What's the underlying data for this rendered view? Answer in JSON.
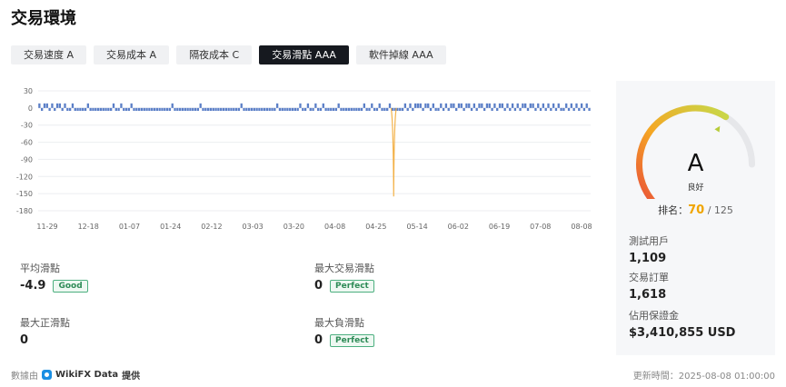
{
  "page": {
    "title": "交易環境"
  },
  "tabs": [
    {
      "label": "交易速度 A",
      "active": false
    },
    {
      "label": "交易成本 A",
      "active": false
    },
    {
      "label": "隔夜成本 C",
      "active": false
    },
    {
      "label": "交易滑點 AAA",
      "active": true
    },
    {
      "label": "軟件掉線 AAA",
      "active": false
    }
  ],
  "chart_data": {
    "type": "bar",
    "ylim": [
      -180,
      30
    ],
    "yticks": [
      "30",
      "0",
      "-30",
      "-60",
      "-90",
      "-120",
      "-150",
      "-180"
    ],
    "xticks": [
      "11-29",
      "12-18",
      "01-07",
      "01-24",
      "02-12",
      "03-03",
      "03-20",
      "04-08",
      "04-25",
      "05-14",
      "06-02",
      "06-19",
      "07-08",
      "08-08"
    ],
    "bar_color": "#5b7fc7",
    "spike_color": "#f3b24a",
    "spike": {
      "position_fraction": 0.6435,
      "value": -155
    },
    "pattern": [
      8,
      -5,
      8,
      8,
      -5,
      8,
      -5,
      8,
      8,
      -5,
      8,
      -5,
      -5,
      8,
      -5,
      -5,
      -5,
      -5,
      -5,
      8,
      -5,
      -5,
      -5,
      -5,
      -5,
      -5,
      -5,
      -5,
      -5,
      8,
      -5,
      -5,
      8,
      -5,
      -5,
      -5,
      8,
      -5,
      -5,
      -5,
      -5,
      -5,
      -5,
      -5,
      -5,
      -5,
      -5,
      -5,
      -5,
      -5,
      -5,
      -5,
      8,
      -5,
      -5,
      -5,
      -5,
      -5,
      -5,
      -5,
      -5,
      -5,
      -5,
      8,
      -5,
      -5,
      -5,
      -5,
      -5,
      -5,
      -5,
      -5,
      -5,
      -5,
      -5,
      -5,
      -5,
      -5,
      -5,
      8,
      -5,
      -5,
      -5,
      -5,
      -5,
      -5,
      -5,
      -5,
      -5,
      -5,
      -5,
      -5,
      -5,
      8,
      -5,
      -5,
      -5,
      -5,
      -5,
      -5,
      -5,
      -5,
      8,
      -5,
      -5,
      8,
      -5,
      -5,
      8,
      -5,
      -5,
      8,
      -5,
      -5,
      -5,
      -5,
      -5,
      8,
      -5,
      -5,
      -5,
      -5,
      -5,
      -5,
      -5,
      -5,
      -5,
      8,
      -5,
      -5,
      8,
      -5,
      -5,
      8,
      -5,
      -5,
      -5,
      8,
      -5,
      -5,
      -5,
      -5,
      -5,
      8,
      -5,
      8,
      -5,
      8,
      8,
      8,
      -5,
      8,
      8,
      -5,
      8,
      -5,
      -5,
      8,
      -5,
      8,
      -5,
      8,
      8,
      -5,
      8,
      8,
      -5,
      8,
      8,
      -5,
      8,
      -5,
      8,
      8,
      -5,
      8,
      8,
      -5,
      8,
      -5,
      8,
      8,
      -5,
      8,
      -5,
      8,
      -5,
      8,
      -5,
      8,
      8,
      -5,
      8,
      8,
      -5,
      8,
      -5,
      8,
      -5,
      8,
      -5,
      8,
      -5,
      8,
      -5,
      -5,
      8,
      -5,
      8,
      -5,
      8,
      -5,
      8,
      -5,
      8,
      -5
    ]
  },
  "stats": {
    "avg_slippage": {
      "label": "平均滑點",
      "value": "-4.9",
      "badge": "Good"
    },
    "max_trade_slippage": {
      "label": "最大交易滑點",
      "value": "0",
      "badge": "Perfect"
    },
    "max_positive_slippage": {
      "label": "最大正滑點",
      "value": "0"
    },
    "max_negative_slippage": {
      "label": "最大負滑點",
      "value": "0",
      "badge": "Perfect"
    }
  },
  "footer": {
    "source_prefix": "數據由",
    "source_name": "WikiFX Data",
    "source_suffix": "提供",
    "updated": "更新時間：2025-08-08 01:00:00"
  },
  "side": {
    "grade": "A",
    "grade_text": "良好",
    "rank_label": "排名：",
    "rank": "70",
    "rank_total": "/ 125",
    "gauge_fraction": 0.76,
    "stats": [
      {
        "label": "測試用戶",
        "value": "1,109"
      },
      {
        "label": "交易訂單",
        "value": "1,618"
      },
      {
        "label": "佔用保證金",
        "value": "$3,410,855 USD"
      }
    ]
  }
}
